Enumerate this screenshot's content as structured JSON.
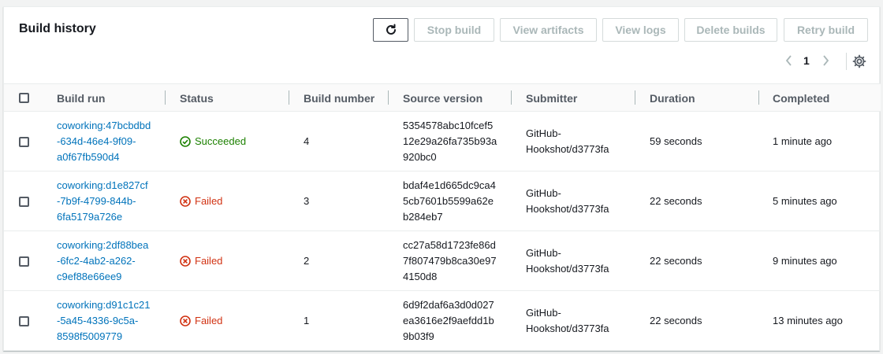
{
  "header": {
    "title": "Build history",
    "buttons": {
      "stop": "Stop build",
      "artifacts": "View artifacts",
      "logs": "View logs",
      "delete": "Delete builds",
      "retry": "Retry build"
    },
    "page": "1"
  },
  "columns": [
    "Build run",
    "Status",
    "Build number",
    "Source version",
    "Submitter",
    "Duration",
    "Completed"
  ],
  "rows": [
    {
      "run_lines": [
        "coworking:47bcbdbd",
        "-634d-46e4-9f09-",
        "a0f67fb590d4"
      ],
      "status": "Succeeded",
      "status_kind": "success",
      "number": "4",
      "source_lines": [
        "5354578abc10fcef5",
        "12e29a26fa735b93a",
        "920bc0"
      ],
      "submitter_lines": [
        "GitHub-",
        "Hookshot/d3773fa"
      ],
      "duration": "59 seconds",
      "completed": "1 minute ago"
    },
    {
      "run_lines": [
        "coworking:d1e827cf",
        "-7b9f-4799-844b-",
        "6fa5179a726e"
      ],
      "status": "Failed",
      "status_kind": "failed",
      "number": "3",
      "source_lines": [
        "bdaf4e1d665dc9ca4",
        "5cb7601b5599a62e",
        "b284eb7"
      ],
      "submitter_lines": [
        "GitHub-",
        "Hookshot/d3773fa"
      ],
      "duration": "22 seconds",
      "completed": "5 minutes ago"
    },
    {
      "run_lines": [
        "coworking:2df88bea",
        "-6fc2-4ab2-a262-",
        "c9ef88e66ee9"
      ],
      "status": "Failed",
      "status_kind": "failed",
      "number": "2",
      "source_lines": [
        "cc27a58d1723fe86d",
        "7f807479b8ca30e97",
        "4150d8"
      ],
      "submitter_lines": [
        "GitHub-",
        "Hookshot/d3773fa"
      ],
      "duration": "22 seconds",
      "completed": "9 minutes ago"
    },
    {
      "run_lines": [
        "coworking:d91c1c21",
        "-5a45-4336-9c5a-",
        "8598f5009779"
      ],
      "status": "Failed",
      "status_kind": "failed",
      "number": "1",
      "source_lines": [
        "6d9f2daf6a3d0d027",
        "ea3616e2f9aefdd1b",
        "9b03f9"
      ],
      "submitter_lines": [
        "GitHub-",
        "Hookshot/d3773fa"
      ],
      "duration": "22 seconds",
      "completed": "13 minutes ago"
    }
  ],
  "icons": {
    "refresh": "refresh-icon",
    "prev": "chevron-left-icon",
    "next": "chevron-right-icon",
    "settings": "gear-icon",
    "success": "check-circle-icon",
    "failed": "x-circle-icon"
  },
  "colors": {
    "link": "#0073bb",
    "success": "#1d8102",
    "failed": "#d13212",
    "disabled_text": "#aab7b8"
  }
}
